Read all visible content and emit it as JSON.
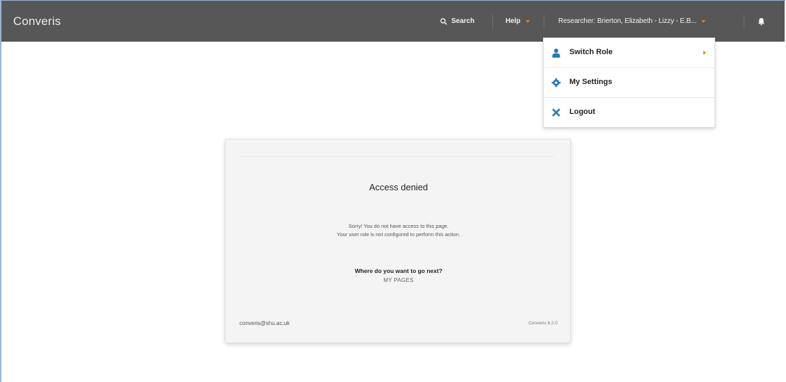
{
  "app": {
    "brand": "Converis"
  },
  "topnav": {
    "search_label": "Search",
    "help_label": "Help",
    "user_label": "Researcher: Brierton, Elizabeth - Lizzy - E.B...",
    "bell_icon": "bell-icon",
    "caret_color": "#e67e22"
  },
  "user_menu": {
    "items": [
      {
        "label": "Switch Role",
        "icon": "user-icon",
        "has_submenu": true
      },
      {
        "label": "My Settings",
        "icon": "gear-icon",
        "has_submenu": false
      },
      {
        "label": "Logout",
        "icon": "close-icon",
        "has_submenu": false
      }
    ]
  },
  "access_card": {
    "title": "Access denied",
    "message_line1": "Sorry! You do not have access to this page.",
    "message_line2": "Your user role is not configured to perform this action.",
    "next_prompt": "Where do you want to go next?",
    "next_link": "MY PAGES",
    "contact_email": "converis@shu.ac.uk",
    "version": "Converis 6.2.0"
  },
  "colors": {
    "topbar": "#575757",
    "accent": "#e67e22",
    "icon_blue": "#2a78b4"
  }
}
